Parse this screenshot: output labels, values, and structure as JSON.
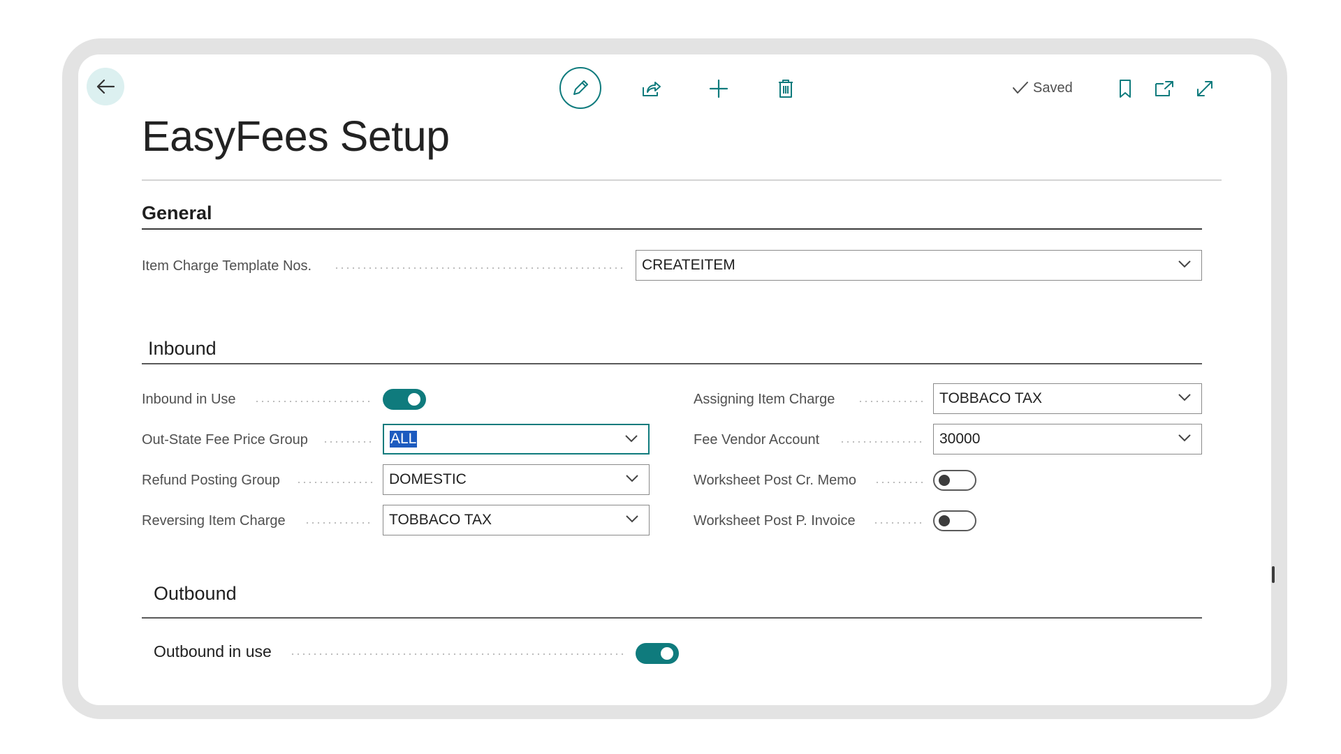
{
  "header": {
    "title": "EasyFees Setup",
    "saved_label": "Saved"
  },
  "icons": {
    "back": "arrow-left-icon",
    "edit": "pencil-icon",
    "share": "share-icon",
    "new": "plus-icon",
    "delete": "trash-icon",
    "saved": "checkmark-icon",
    "bookmark": "bookmark-icon",
    "open_new": "open-in-new-window-icon",
    "expand": "expand-icon"
  },
  "colors": {
    "accent": "#0f7b7d",
    "selection": "#1d5bbf"
  },
  "general": {
    "title": "General",
    "fields": {
      "item_charge_template_nos": {
        "label": "Item Charge Template Nos.",
        "value": "CREATEITEM"
      }
    }
  },
  "inbound": {
    "title": "Inbound",
    "fields": {
      "inbound_in_use": {
        "label": "Inbound in Use",
        "on": true
      },
      "out_state_fee_price_group": {
        "label": "Out-State Fee Price Group",
        "value": "ALL"
      },
      "refund_posting_group": {
        "label": "Refund Posting Group",
        "value": "DOMESTIC"
      },
      "reversing_item_charge": {
        "label": "Reversing Item Charge",
        "value": "TOBBACO TAX"
      },
      "assigning_item_charge": {
        "label": "Assigning Item Charge",
        "value": "TOBBACO TAX"
      },
      "fee_vendor_account": {
        "label": "Fee Vendor Account",
        "value": "30000"
      },
      "worksheet_post_cr_memo": {
        "label": "Worksheet Post Cr. Memo",
        "on": false
      },
      "worksheet_post_p_invoice": {
        "label": "Worksheet Post P. Invoice",
        "on": false
      }
    }
  },
  "outbound": {
    "title": "Outbound",
    "fields": {
      "outbound_in_use": {
        "label": "Outbound in use",
        "on": true
      }
    }
  }
}
